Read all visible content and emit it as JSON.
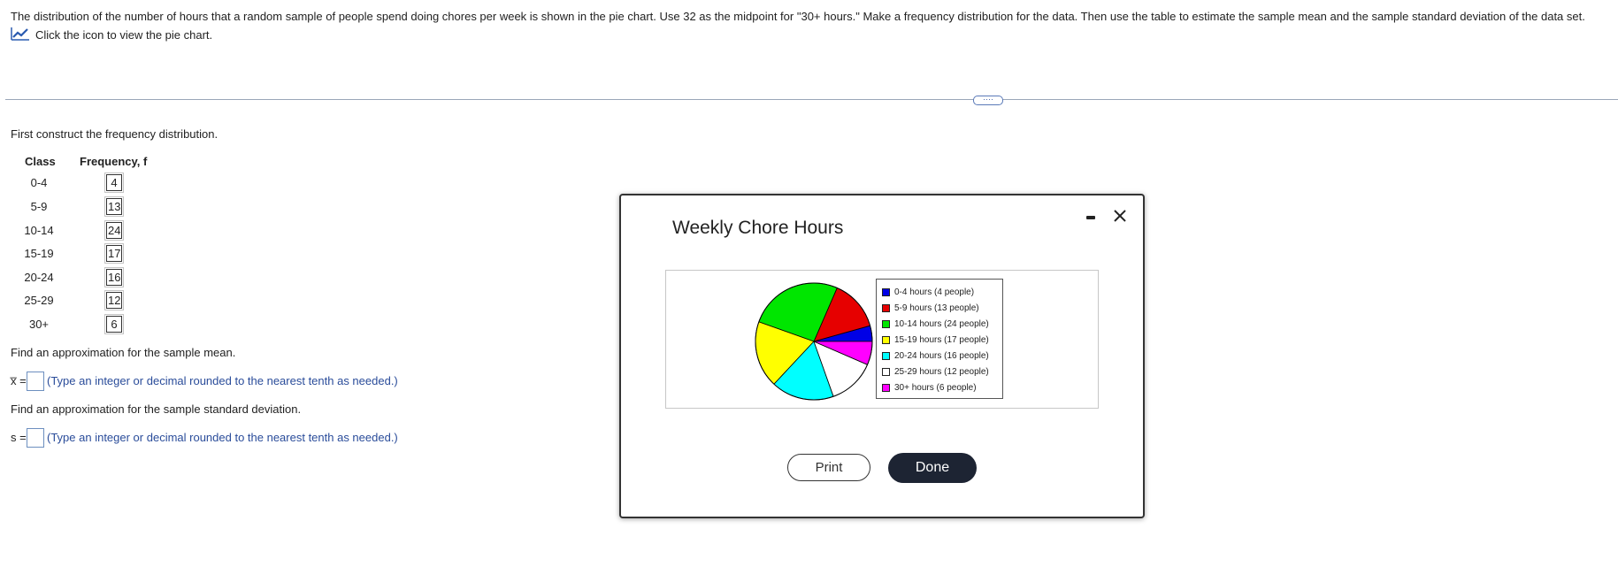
{
  "problem": {
    "text": "The distribution of the number of hours that a random sample of people spend doing chores per week is shown in the pie chart. Use 32 as the midpoint for \"30+ hours.\" Make a frequency distribution for the data. Then use the table to estimate the sample mean and the sample standard deviation of the data set.",
    "chart_link_label": "Click the icon to view the pie chart.",
    "chart_link_icon": "line-chart-icon"
  },
  "more_button_label": "····",
  "section": {
    "instruction": "First construct the frequency distribution.",
    "table": {
      "headers": [
        "Class",
        "Frequency, f"
      ],
      "rows": [
        {
          "class": "0-4",
          "freq": "4"
        },
        {
          "class": "5-9",
          "freq": "13"
        },
        {
          "class": "10-14",
          "freq": "24"
        },
        {
          "class": "15-19",
          "freq": "17"
        },
        {
          "class": "20-24",
          "freq": "16"
        },
        {
          "class": "25-29",
          "freq": "12"
        },
        {
          "class": "30+",
          "freq": "6"
        }
      ]
    },
    "mean_prompt": "Find an approximation for the sample mean.",
    "mean_label": "x̅ =",
    "mean_hint": "(Type an integer or decimal rounded to the nearest tenth as needed.)",
    "sd_prompt": "Find an approximation for the sample standard deviation.",
    "sd_label": "s =",
    "sd_hint": "(Type an integer or decimal rounded to the nearest tenth as needed.)"
  },
  "dialog": {
    "title": "Weekly Chore Hours",
    "minimize_icon": "minimize-icon",
    "close_icon": "close-icon",
    "print_label": "Print",
    "done_label": "Done"
  },
  "chart_data": {
    "type": "pie",
    "title": "Weekly Chore Hours",
    "legend_position": "right",
    "slices": [
      {
        "label": "0-4 hours (4 people)",
        "value": 4,
        "color": "#0000e6"
      },
      {
        "label": "5-9 hours (13 people)",
        "value": 13,
        "color": "#e60000"
      },
      {
        "label": "10-14 hours (24 people)",
        "value": 24,
        "color": "#00e600"
      },
      {
        "label": "15-19 hours (17 people)",
        "value": 17,
        "color": "#ffff00"
      },
      {
        "label": "20-24 hours (16 people)",
        "value": 16,
        "color": "#00ffff"
      },
      {
        "label": "25-29 hours (12 people)",
        "value": 12,
        "color": "#ffffff"
      },
      {
        "label": "30+ hours (6 people)",
        "value": 6,
        "color": "#ff00ff"
      }
    ]
  }
}
